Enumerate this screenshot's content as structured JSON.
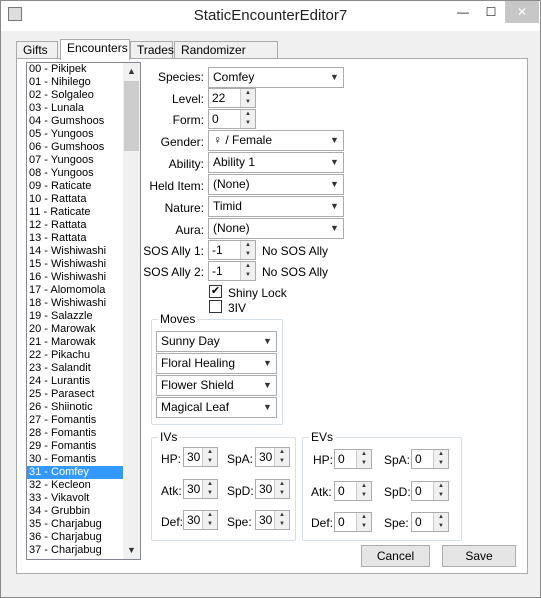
{
  "window": {
    "title": "StaticEncounterEditor7",
    "min": "—",
    "max": "☐",
    "close": "✕"
  },
  "tabs": [
    "Gifts",
    "Encounters",
    "Trades",
    "Randomizer Options"
  ],
  "list": [
    "00 - Pikipek",
    "01 - Nihilego",
    "02 - Solgaleo",
    "03 - Lunala",
    "04 - Gumshoos",
    "05 - Yungoos",
    "06 - Gumshoos",
    "07 - Yungoos",
    "08 - Yungoos",
    "09 - Raticate",
    "10 - Rattata",
    "11 - Raticate",
    "12 - Rattata",
    "13 - Rattata",
    "14 - Wishiwashi",
    "15 - Wishiwashi",
    "16 - Wishiwashi",
    "17 - Alomomola",
    "18 - Wishiwashi",
    "19 - Salazzle",
    "20 - Marowak",
    "21 - Marowak",
    "22 - Pikachu",
    "23 - Salandit",
    "24 - Lurantis",
    "25 - Parasect",
    "26 - Shiinotic",
    "27 - Fomantis",
    "28 - Fomantis",
    "29 - Fomantis",
    "30 - Fomantis",
    "31 - Comfey",
    "32 - Kecleon",
    "33 - Vikavolt",
    "34 - Grubbin",
    "35 - Charjabug",
    "36 - Charjabug",
    "37 - Charjabug"
  ],
  "selected_index": 31,
  "form": {
    "species_label": "Species:",
    "species": "Comfey",
    "level_label": "Level:",
    "level": "22",
    "form_label": "Form:",
    "form": "0",
    "gender_label": "Gender:",
    "gender": "♀ / Female",
    "ability_label": "Ability:",
    "ability": "Ability 1",
    "helditem_label": "Held Item:",
    "helditem": "(None)",
    "nature_label": "Nature:",
    "nature": "Timid",
    "aura_label": "Aura:",
    "aura": "(None)",
    "sos1_label": "SOS Ally 1:",
    "sos1": "-1",
    "sos1_note": "No SOS Ally",
    "sos2_label": "SOS Ally 2:",
    "sos2": "-1",
    "sos2_note": "No SOS Ally",
    "shiny_label": "Shiny Lock",
    "shiny_checked": true,
    "iv3_label": "3IV",
    "iv3_checked": false
  },
  "moves": {
    "title": "Moves",
    "list": [
      "Sunny Day",
      "Floral Healing",
      "Flower Shield",
      "Magical Leaf"
    ]
  },
  "ivs": {
    "title": "IVs",
    "hp_label": "HP:",
    "hp": "30",
    "atk_label": "Atk:",
    "atk": "30",
    "def_label": "Def:",
    "def": "30",
    "spa_label": "SpA:",
    "spa": "30",
    "spd_label": "SpD:",
    "spd": "30",
    "spe_label": "Spe:",
    "spe": "30"
  },
  "evs": {
    "title": "EVs",
    "hp_label": "HP:",
    "hp": "0",
    "atk_label": "Atk:",
    "atk": "0",
    "def_label": "Def:",
    "def": "0",
    "spa_label": "SpA:",
    "spa": "0",
    "spd_label": "SpD:",
    "spd": "0",
    "spe_label": "Spe:",
    "spe": "0"
  },
  "buttons": {
    "cancel": "Cancel",
    "save": "Save"
  }
}
